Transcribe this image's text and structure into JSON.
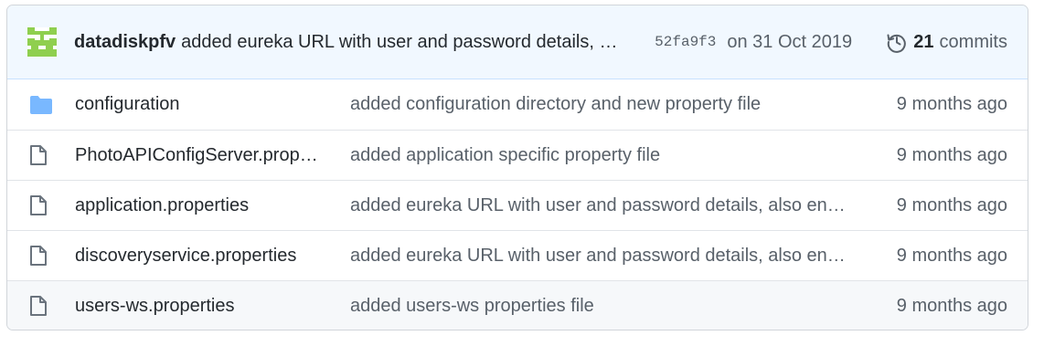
{
  "latest_commit": {
    "author": "datadiskpfv",
    "message": "added eureka URL with user and password details, also enabled security",
    "sha": "52fa9f3",
    "date": "on 31 Oct 2019",
    "commit_count": "21",
    "commits_label": "commits"
  },
  "files": [
    {
      "type": "folder",
      "name": "configuration",
      "message": "added configuration directory and new property file",
      "age": "9 months ago"
    },
    {
      "type": "file",
      "name": "PhotoAPIConfigServer.properties",
      "message": "added application specific property file",
      "age": "9 months ago"
    },
    {
      "type": "file",
      "name": "application.properties",
      "message": "added eureka URL with user and password details, also enabled security",
      "age": "9 months ago"
    },
    {
      "type": "file",
      "name": "discoveryservice.properties",
      "message": "added eureka URL with user and password details, also enabled security",
      "age": "9 months ago"
    },
    {
      "type": "file",
      "name": "users-ws.properties",
      "message": "added users-ws properties file",
      "age": "9 months ago"
    }
  ],
  "colors": {
    "header_bg": "#f1f8ff",
    "folder_icon": "#79b8ff",
    "file_icon": "#6a737d",
    "avatar": "#8fcf4f"
  }
}
